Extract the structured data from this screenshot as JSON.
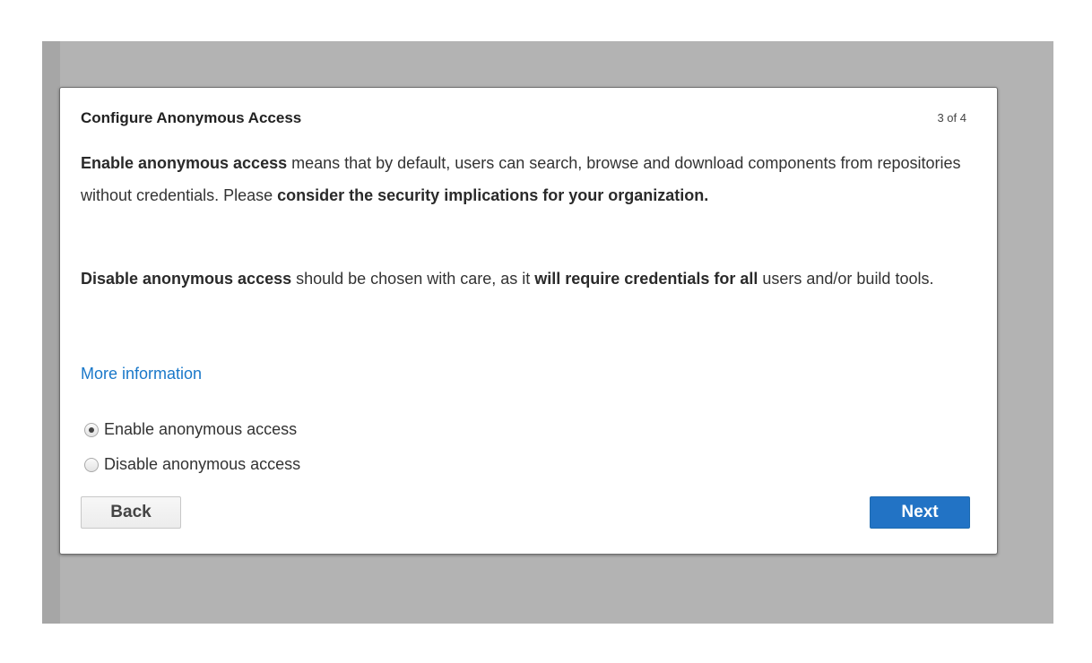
{
  "dialog": {
    "title": "Configure Anonymous Access",
    "step": "3 of 4",
    "paragraph1": {
      "bold1": "Enable anonymous access",
      "text1": " means that by default, users can search, browse and download components from repositories without credentials. Please ",
      "bold2": "consider the security implications for your organization."
    },
    "paragraph2": {
      "bold1": "Disable anonymous access",
      "text1": " should be chosen with care, as it ",
      "bold2": "will require credentials for all",
      "text2": " users and/or build tools."
    },
    "more_info_link": "More information",
    "options": [
      {
        "label": "Enable anonymous access",
        "selected": true
      },
      {
        "label": "Disable anonymous access",
        "selected": false
      }
    ],
    "back_label": "Back",
    "next_label": "Next"
  },
  "colors": {
    "backdrop": "#b3b3b3",
    "link": "#1a78c9",
    "primary_button": "#2273c5"
  }
}
